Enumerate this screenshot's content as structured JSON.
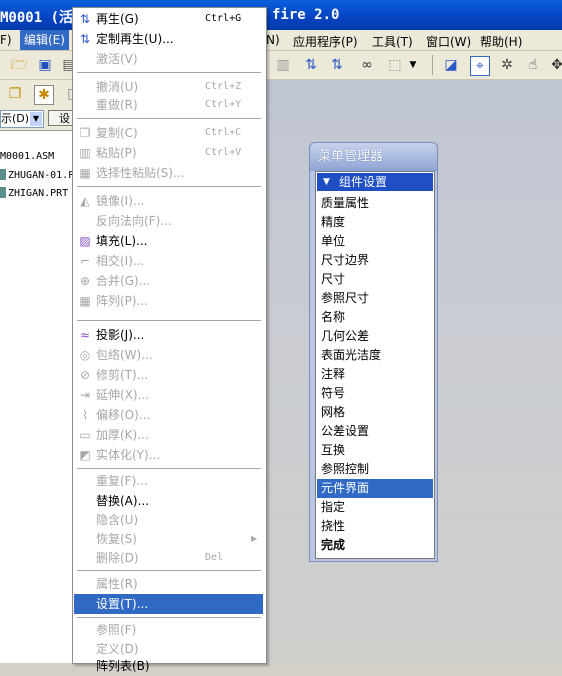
{
  "window": {
    "title_left": "M0001 (活",
    "title_right": "fire 2.0"
  },
  "menubar": {
    "items": [
      {
        "label": "F)"
      },
      {
        "label": "编辑(E)"
      },
      {
        "label": "N)"
      },
      {
        "label": "应用程序(P)"
      },
      {
        "label": "工具(T)"
      },
      {
        "label": "窗口(W)"
      },
      {
        "label": "帮助(H)"
      }
    ]
  },
  "toolbar": {
    "display_select": "示(D)",
    "short_button": "设"
  },
  "tree": {
    "items": [
      {
        "label": "M0001.ASM"
      },
      {
        "label": "ZHUGAN-01.P"
      },
      {
        "label": "ZHIGAN.PRT"
      }
    ]
  },
  "edit_menu": {
    "items": [
      {
        "label": "再生(G)",
        "shortcut": "Ctrl+G",
        "enabled": true,
        "icon": "regenerate-icon"
      },
      {
        "label": "定制再生(U)...",
        "shortcut": "",
        "enabled": true,
        "icon": "custom-regenerate-icon"
      },
      {
        "label": "激活(V)",
        "shortcut": "",
        "enabled": false,
        "icon": ""
      },
      {
        "label": "撤消(U)",
        "shortcut": "Ctrl+Z",
        "enabled": false,
        "icon": ""
      },
      {
        "label": "重做(R)",
        "shortcut": "Ctrl+Y",
        "enabled": false,
        "icon": ""
      },
      {
        "label": "复制(C)",
        "shortcut": "Ctrl+C",
        "enabled": false,
        "icon": "copy-icon"
      },
      {
        "label": "粘贴(P)",
        "shortcut": "Ctrl+V",
        "enabled": false,
        "icon": "paste-icon"
      },
      {
        "label": "选择性粘贴(S)...",
        "shortcut": "",
        "enabled": false,
        "icon": "paste-special-icon"
      },
      {
        "label": "镜像(I)...",
        "shortcut": "",
        "enabled": false,
        "icon": "mirror-icon"
      },
      {
        "label": "反向法向(F)...",
        "shortcut": "",
        "enabled": false,
        "icon": ""
      },
      {
        "label": "填充(L)...",
        "shortcut": "",
        "enabled": true,
        "icon": "fill-icon"
      },
      {
        "label": "相交(I)...",
        "shortcut": "",
        "enabled": false,
        "icon": "intersect-icon"
      },
      {
        "label": "合并(G)...",
        "shortcut": "",
        "enabled": false,
        "icon": "merge-icon"
      },
      {
        "label": "阵列(P)...",
        "shortcut": "",
        "enabled": false,
        "icon": "pattern-icon"
      },
      {
        "label": "投影(J)...",
        "shortcut": "",
        "enabled": true,
        "icon": "project-icon"
      },
      {
        "label": "包络(W)...",
        "shortcut": "",
        "enabled": false,
        "icon": "wrap-icon"
      },
      {
        "label": "修剪(T)...",
        "shortcut": "",
        "enabled": false,
        "icon": "trim-icon"
      },
      {
        "label": "延伸(X)...",
        "shortcut": "",
        "enabled": false,
        "icon": "extend-icon"
      },
      {
        "label": "偏移(O)...",
        "shortcut": "",
        "enabled": false,
        "icon": "offset-icon"
      },
      {
        "label": "加厚(K)...",
        "shortcut": "",
        "enabled": false,
        "icon": "thicken-icon"
      },
      {
        "label": "实体化(Y)...",
        "shortcut": "",
        "enabled": false,
        "icon": "solidify-icon"
      },
      {
        "label": "重复(F)...",
        "shortcut": "",
        "enabled": false,
        "icon": ""
      },
      {
        "label": "替换(A)...",
        "shortcut": "",
        "enabled": true,
        "icon": ""
      },
      {
        "label": "隐含(U)",
        "shortcut": "",
        "enabled": false,
        "icon": ""
      },
      {
        "label": "恢复(S)",
        "shortcut": "",
        "enabled": false,
        "icon": ""
      },
      {
        "label": "删除(D)",
        "shortcut": "Del",
        "enabled": false,
        "icon": ""
      },
      {
        "label": "属性(R)",
        "shortcut": "",
        "enabled": false,
        "icon": ""
      },
      {
        "label": "设置(T)...",
        "shortcut": "",
        "enabled": true,
        "icon": ""
      },
      {
        "label": "参照(F)",
        "shortcut": "",
        "enabled": false,
        "icon": ""
      },
      {
        "label": "定义(D)",
        "shortcut": "",
        "enabled": false,
        "icon": ""
      },
      {
        "label": "阵列表(B)",
        "shortcut": "",
        "enabled": true,
        "icon": ""
      }
    ]
  },
  "menu_manager": {
    "title": "菜单管理器",
    "header": "组件设置",
    "items": [
      {
        "label": "质量属性"
      },
      {
        "label": "精度"
      },
      {
        "label": "单位"
      },
      {
        "label": "尺寸边界"
      },
      {
        "label": "尺寸"
      },
      {
        "label": "参照尺寸"
      },
      {
        "label": "名称"
      },
      {
        "label": "几何公差"
      },
      {
        "label": "表面光洁度"
      },
      {
        "label": "注释"
      },
      {
        "label": "符号"
      },
      {
        "label": "网格"
      },
      {
        "label": "公差设置"
      },
      {
        "label": "互换"
      },
      {
        "label": "参照控制"
      },
      {
        "label": "元件界面"
      },
      {
        "label": "指定"
      },
      {
        "label": "挠性"
      },
      {
        "label": "完成"
      }
    ],
    "selected": "元件界面",
    "bold_item": "完成"
  },
  "colors": {
    "title_blue": "#0645c4",
    "highlight": "#316ac5",
    "disabled_text": "#a7a6aa",
    "menu_manager_frame": "#b8c6e3"
  }
}
